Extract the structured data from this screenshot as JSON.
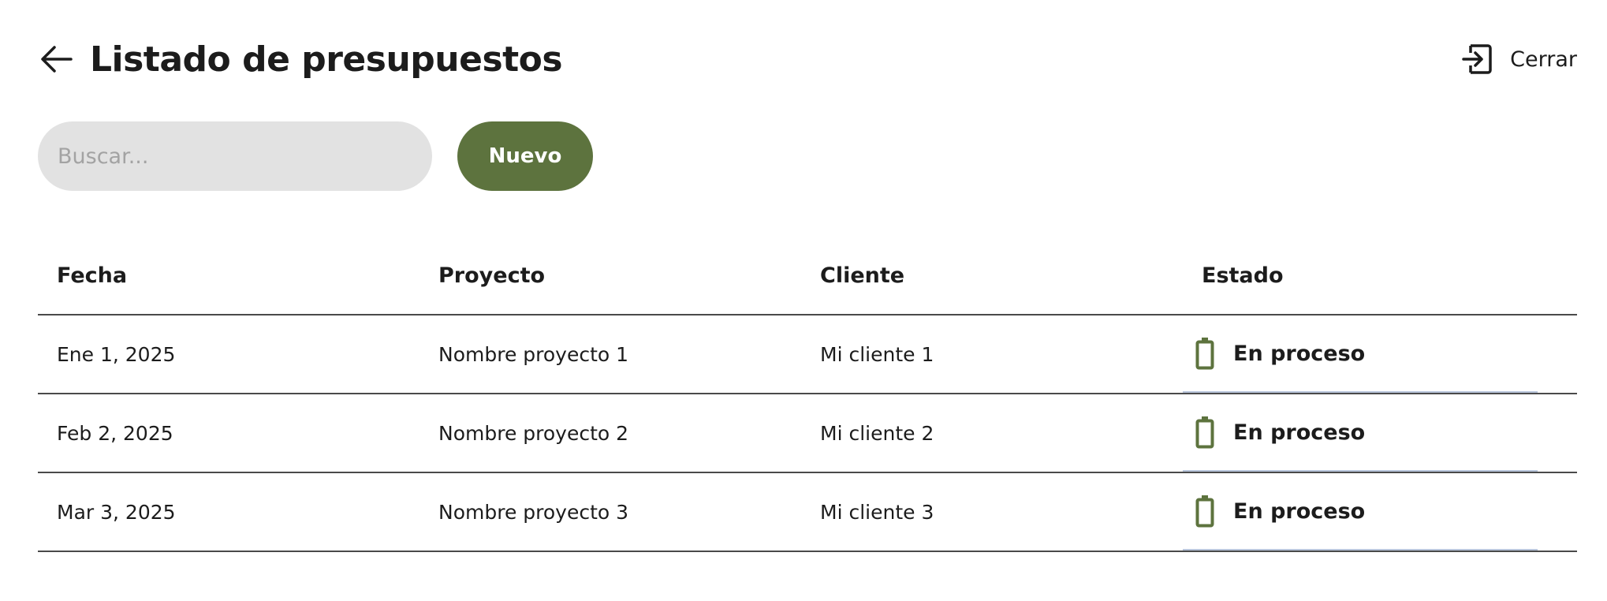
{
  "header": {
    "title": "Listado de presupuestos",
    "close_label": "Cerrar",
    "back_icon": "arrow-left-icon",
    "close_icon": "exit-icon"
  },
  "toolbar": {
    "search_placeholder": "Buscar...",
    "search_value": "",
    "new_label": "Nuevo"
  },
  "table": {
    "columns": [
      "Fecha",
      "Proyecto",
      "Cliente",
      "Estado"
    ],
    "rows": [
      {
        "fecha": "Ene 1, 2025",
        "proyecto": "Nombre proyecto 1",
        "cliente": "Mi cliente 1",
        "estado": "En proceso"
      },
      {
        "fecha": "Feb 2, 2025",
        "proyecto": "Nombre proyecto 2",
        "cliente": "Mi cliente 2",
        "estado": "En proceso"
      },
      {
        "fecha": "Mar 3, 2025",
        "proyecto": "Nombre proyecto 3",
        "cliente": "Mi cliente 3",
        "estado": "En proceso"
      }
    ]
  },
  "colors": {
    "accent": "#5d733e",
    "search_bg": "#e2e2e2",
    "text": "#1c1c1c",
    "divider": "#4a4a4a",
    "status_underline": "#b9c6dc"
  }
}
